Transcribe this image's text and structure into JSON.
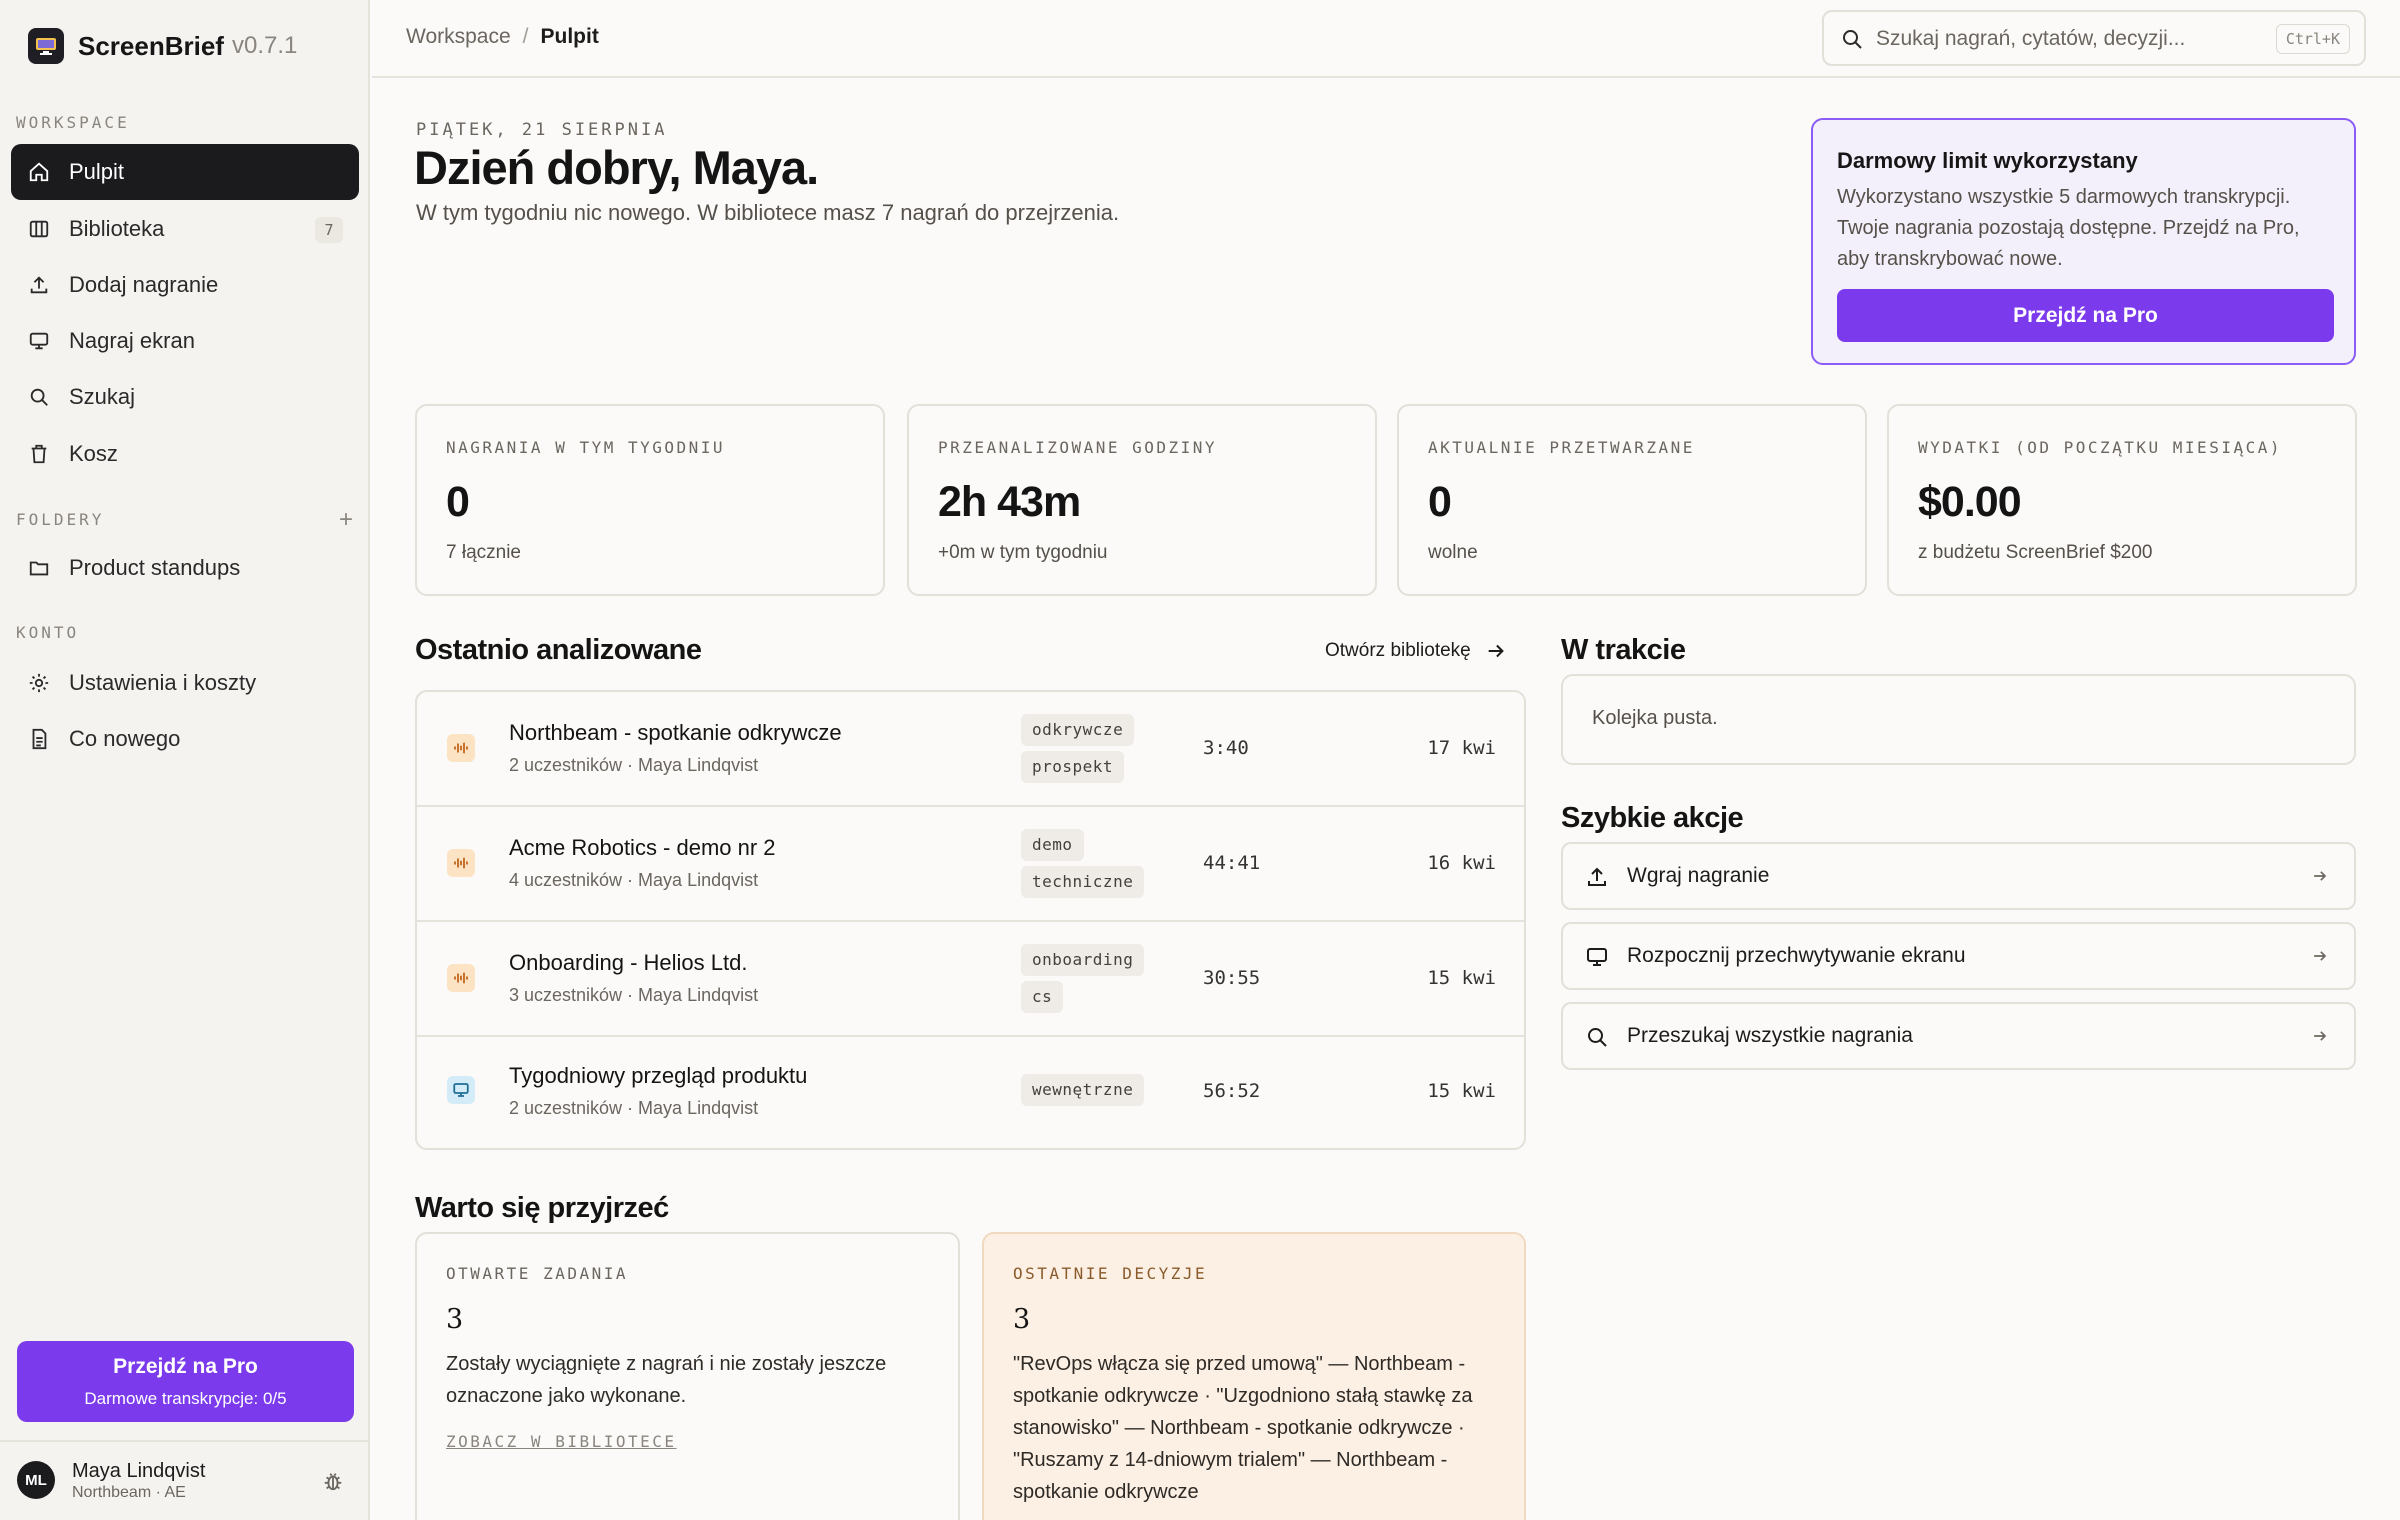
{
  "app": {
    "name": "ScreenBrief",
    "version": "v0.7.1"
  },
  "sidebar": {
    "workspace_label": "WORKSPACE",
    "items": [
      {
        "label": "Pulpit",
        "icon": "home-icon",
        "active": true
      },
      {
        "label": "Biblioteka",
        "icon": "library-icon",
        "badge": "7"
      },
      {
        "label": "Dodaj nagranie",
        "icon": "upload-icon"
      },
      {
        "label": "Nagraj ekran",
        "icon": "monitor-icon"
      },
      {
        "label": "Szukaj",
        "icon": "search-icon"
      },
      {
        "label": "Kosz",
        "icon": "trash-icon"
      }
    ],
    "folders_label": "FOLDERY",
    "folders": [
      {
        "label": "Product standups",
        "icon": "folder-icon"
      }
    ],
    "account_label": "KONTO",
    "account_items": [
      {
        "label": "Ustawienia i koszty",
        "icon": "settings-icon"
      },
      {
        "label": "Co nowego",
        "icon": "document-icon"
      }
    ],
    "pro_button": {
      "title": "Przejdź na Pro",
      "subtitle": "Darmowe transkrypcje: 0/5"
    },
    "user": {
      "initials": "ML",
      "name": "Maya Lindqvist",
      "subtitle": "Northbeam · AE"
    }
  },
  "header": {
    "breadcrumb": [
      "Workspace",
      "Pulpit"
    ],
    "breadcrumb_sep": "/",
    "search_placeholder": "Szukaj nagrań, cytatów, decyzji...",
    "search_shortcut": "Ctrl+K"
  },
  "hero": {
    "date": "PIĄTEK, 21 SIERPNIA",
    "greeting": "Dzień dobry, Maya.",
    "subtext": "W tym tygodniu nic nowego. W bibliotece masz 7 nagrań do przejrzenia."
  },
  "limit_card": {
    "title": "Darmowy limit wykorzystany",
    "text": "Wykorzystano wszystkie 5 darmowych transkrypcji. Twoje nagrania pozostają dostępne. Przejdź na Pro, aby transkrybować nowe.",
    "button": "Przejdź na Pro"
  },
  "stats": [
    {
      "label": "NAGRANIA W TYM TYGODNIU",
      "value": "0",
      "sub": "7 łącznie"
    },
    {
      "label": "PRZEANALIZOWANE GODZINY",
      "value": "2h 43m",
      "sub": "+0m w tym tygodniu"
    },
    {
      "label": "AKTUALNIE PRZETWARZANE",
      "value": "0",
      "sub": "wolne"
    },
    {
      "label": "WYDATKI (OD POCZĄTKU MIESIĄCA)",
      "value": "$0.00",
      "sub": "z budżetu ScreenBrief $200"
    }
  ],
  "recent": {
    "title": "Ostatnio analizowane",
    "open_library": "Otwórz bibliotekę",
    "rows": [
      {
        "title": "Northbeam - spotkanie odkrywcze",
        "meta": "2 uczestników · Maya Lindqvist",
        "tags": [
          "odkrywcze",
          "prospekt"
        ],
        "duration": "3:40",
        "date": "17 kwi",
        "kind": "audio"
      },
      {
        "title": "Acme Robotics - demo nr 2",
        "meta": "4 uczestników · Maya Lindqvist",
        "tags": [
          "demo",
          "techniczne"
        ],
        "duration": "44:41",
        "date": "16 kwi",
        "kind": "audio"
      },
      {
        "title": "Onboarding - Helios Ltd.",
        "meta": "3 uczestników · Maya Lindqvist",
        "tags": [
          "onboarding",
          "cs"
        ],
        "duration": "30:55",
        "date": "15 kwi",
        "kind": "audio"
      },
      {
        "title": "Tygodniowy przegląd produktu",
        "meta": "2 uczestników · Maya Lindqvist",
        "tags": [
          "wewnętrzne"
        ],
        "duration": "56:52",
        "date": "15 kwi",
        "kind": "screen"
      }
    ]
  },
  "in_progress": {
    "title": "W trakcie",
    "empty": "Kolejka pusta."
  },
  "quick_actions": {
    "title": "Szybkie akcje",
    "items": [
      {
        "label": "Wgraj nagranie",
        "icon": "upload-icon"
      },
      {
        "label": "Rozpocznij przechwytywanie ekranu",
        "icon": "monitor-icon"
      },
      {
        "label": "Przeszukaj wszystkie nagrania",
        "icon": "search-icon"
      }
    ]
  },
  "worth_a_look": {
    "title": "Warto się przyjrzeć",
    "open_tasks": {
      "label": "OTWARTE ZADANIA",
      "count": "3",
      "text": "Zostały wyciągnięte z nagrań i nie zostały jeszcze oznaczone jako wykonane.",
      "link": "ZOBACZ W BIBLIOTECE"
    },
    "decisions": {
      "label": "OSTATNIE DECYZJE",
      "count": "3",
      "lines": [
        "\"RevOps włącza się przed umową\" — Northbeam -",
        "spotkanie odkrywcze · \"Uzgodniono stałą stawkę za",
        "stanowisko\" — Northbeam - spotkanie odkrywcze ·",
        "\"Ruszamy z 14-dniowym trialem\" — Northbeam -",
        "spotkanie odkrywcze"
      ]
    }
  },
  "colors": {
    "accent": "#7c3aed",
    "dark": "#1b1b1d",
    "background": "#fbfaf8"
  }
}
